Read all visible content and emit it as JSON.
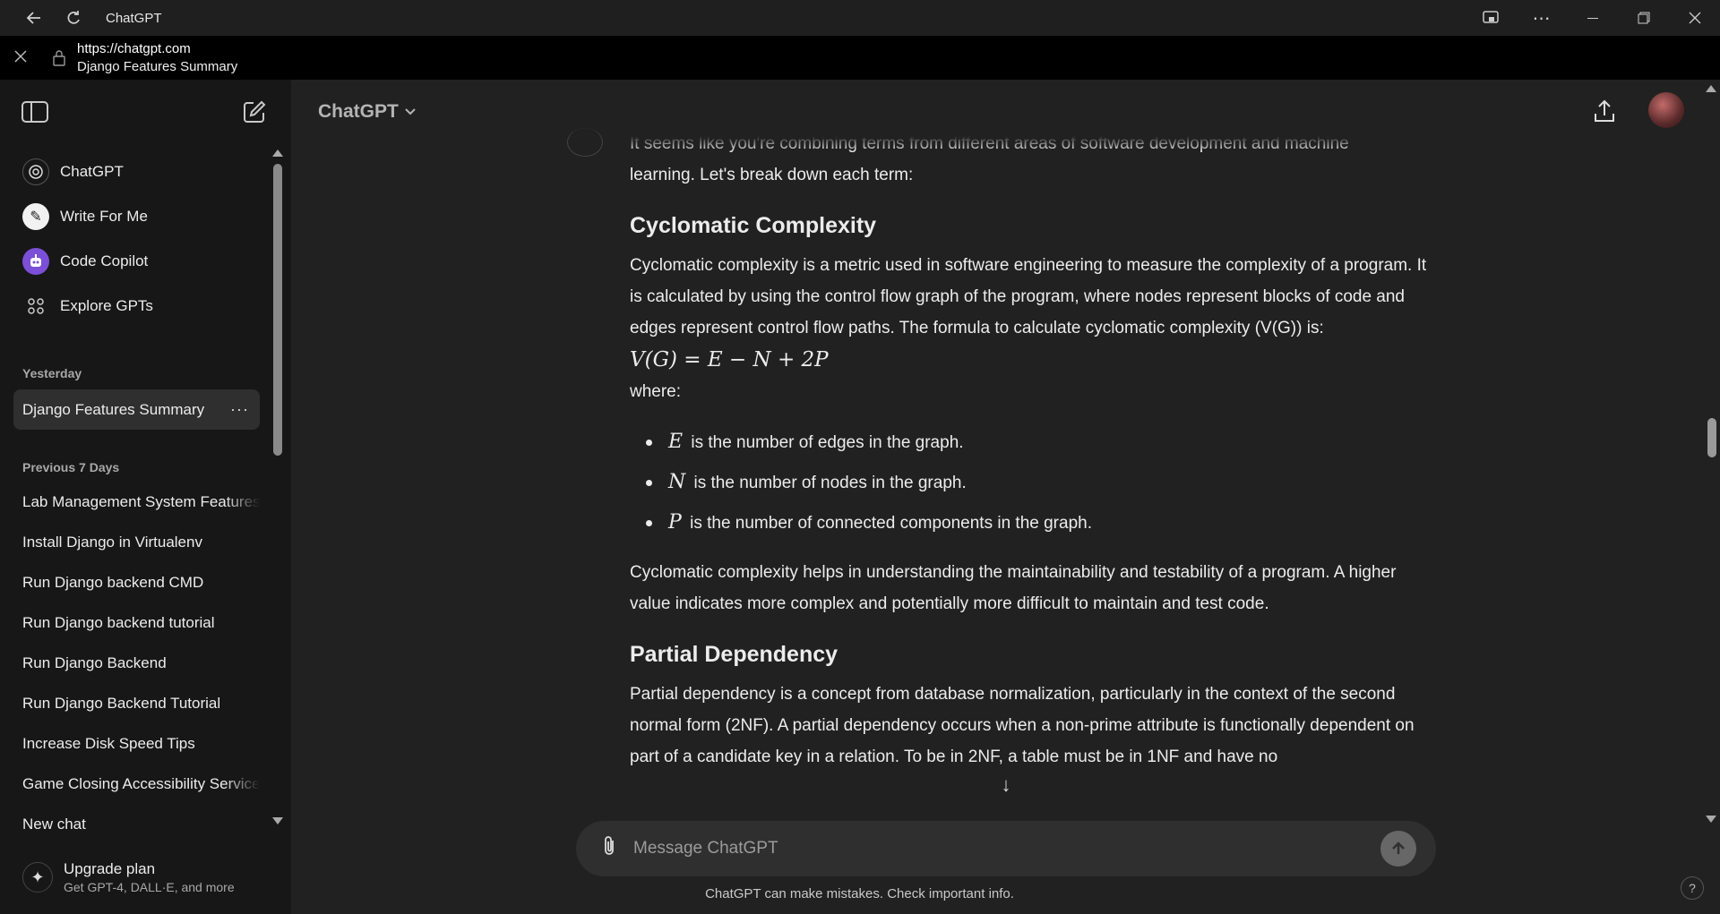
{
  "window": {
    "title": "ChatGPT"
  },
  "address": {
    "url": "https://chatgpt.com",
    "page_title": "Django Features Summary"
  },
  "sidebar": {
    "gpts": [
      {
        "label": "ChatGPT",
        "icon": "openai-logo-icon"
      },
      {
        "label": "Write For Me",
        "icon": "pen-icon"
      },
      {
        "label": "Code Copilot",
        "icon": "robot-icon"
      },
      {
        "label": "Explore GPTs",
        "icon": "grid-icon"
      }
    ],
    "sections": [
      {
        "label": "Yesterday",
        "items": [
          "Django Features Summary"
        ]
      },
      {
        "label": "Previous 7 Days",
        "items": [
          "Lab Management System Features",
          "Install Django in Virtualenv",
          "Run Django backend CMD",
          "Run Django backend tutorial",
          "Run Django Backend",
          "Run Django Backend Tutorial",
          "Increase Disk Speed Tips",
          "Game Closing Accessibility Service",
          "New chat"
        ]
      }
    ],
    "upgrade": {
      "title": "Upgrade plan",
      "subtitle": "Get GPT-4, DALL·E, and more"
    }
  },
  "header": {
    "model": "ChatGPT"
  },
  "message": {
    "intro_line1": "It seems like you're combining terms from different areas of software development and machine",
    "intro_line2": "learning. Let's break down each term:",
    "h1": "Cyclomatic Complexity",
    "p1": "Cyclomatic complexity is a metric used in software engineering to measure the complexity of a program. It is calculated by using the control flow graph of the program, where nodes represent blocks of code and edges represent control flow paths. The formula to calculate cyclomatic complexity (V(G)) is:",
    "formula": "V(G) = E − N + 2P",
    "where": "where:",
    "bullets": [
      {
        "var": "E",
        "text": "is the number of edges in the graph."
      },
      {
        "var": "N",
        "text": "is the number of nodes in the graph."
      },
      {
        "var": "P",
        "text": "is the number of connected components in the graph."
      }
    ],
    "p2": "Cyclomatic complexity helps in understanding the maintainability and testability of a program. A higher value indicates more complex and potentially more difficult to maintain and test code.",
    "h2": "Partial Dependency",
    "p3": "Partial dependency is a concept from database normalization, particularly in the context of the second normal form (2NF). A partial dependency occurs when a non-prime attribute is functionally dependent on part of a candidate key in a relation. To be in 2NF, a table must be in 1NF and have no"
  },
  "composer": {
    "placeholder": "Message ChatGPT"
  },
  "footer": {
    "disclaimer": "ChatGPT can make mistakes. Check important info.",
    "help": "?"
  }
}
